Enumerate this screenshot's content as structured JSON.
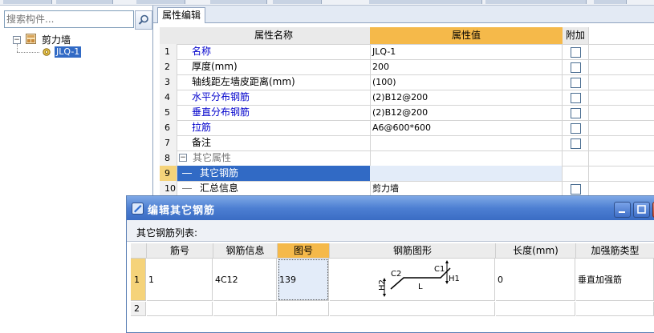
{
  "left_panel": {
    "search_placeholder": "搜索构件...",
    "tree": {
      "root_label": "剪力墙",
      "child_label": "JLQ-1"
    }
  },
  "tabs": {
    "properties": "属性编辑"
  },
  "property_grid": {
    "headers": {
      "name": "属性名称",
      "value": "属性值",
      "extra": "附加"
    },
    "rows": [
      {
        "num": "1",
        "name": "名称",
        "value": "JLQ-1",
        "link": true,
        "check": true
      },
      {
        "num": "2",
        "name": "厚度(mm)",
        "value": "200",
        "link": false,
        "check": true
      },
      {
        "num": "3",
        "name": "轴线距左墙皮距离(mm)",
        "value": "(100)",
        "link": false,
        "check": true
      },
      {
        "num": "4",
        "name": "水平分布钢筋",
        "value": "(2)B12@200",
        "link": true,
        "check": true
      },
      {
        "num": "5",
        "name": "垂直分布钢筋",
        "value": "(2)B12@200",
        "link": true,
        "check": true
      },
      {
        "num": "6",
        "name": "拉筋",
        "value": "A6@600*600",
        "link": true,
        "check": true
      },
      {
        "num": "7",
        "name": "备注",
        "value": "",
        "link": false,
        "check": true
      },
      {
        "num": "8",
        "name": "其它属性",
        "value": "",
        "link": false,
        "check": false,
        "group": true
      },
      {
        "num": "9",
        "name": "其它钢筋",
        "value": "",
        "link": false,
        "check": false,
        "selected": true
      },
      {
        "num": "10",
        "name": "汇总信息",
        "value": "剪力墙",
        "link": false,
        "check": true
      }
    ]
  },
  "dialog": {
    "title": "编辑其它钢筋",
    "list_label": "其它钢筋列表:",
    "headers": [
      "筋号",
      "钢筋信息",
      "图号",
      "钢筋图形",
      "长度(mm)",
      "加强筋类型"
    ],
    "rows": [
      {
        "num": "1",
        "bar_no": "1",
        "info": "4C12",
        "fig": "139",
        "length": "0",
        "type": "垂直加强筋"
      },
      {
        "num": "2",
        "bar_no": "",
        "info": "",
        "fig": "",
        "length": "",
        "type": ""
      }
    ],
    "shape_labels": {
      "c1": "C1",
      "c2": "C2",
      "l": "L",
      "h1": "H1",
      "h2": "H2"
    },
    "colors": {
      "title_bar": "#4d7fd2",
      "selected_row": "#316ac5",
      "link_text": "#0000cc",
      "header_accent": "#f5b94a"
    }
  }
}
